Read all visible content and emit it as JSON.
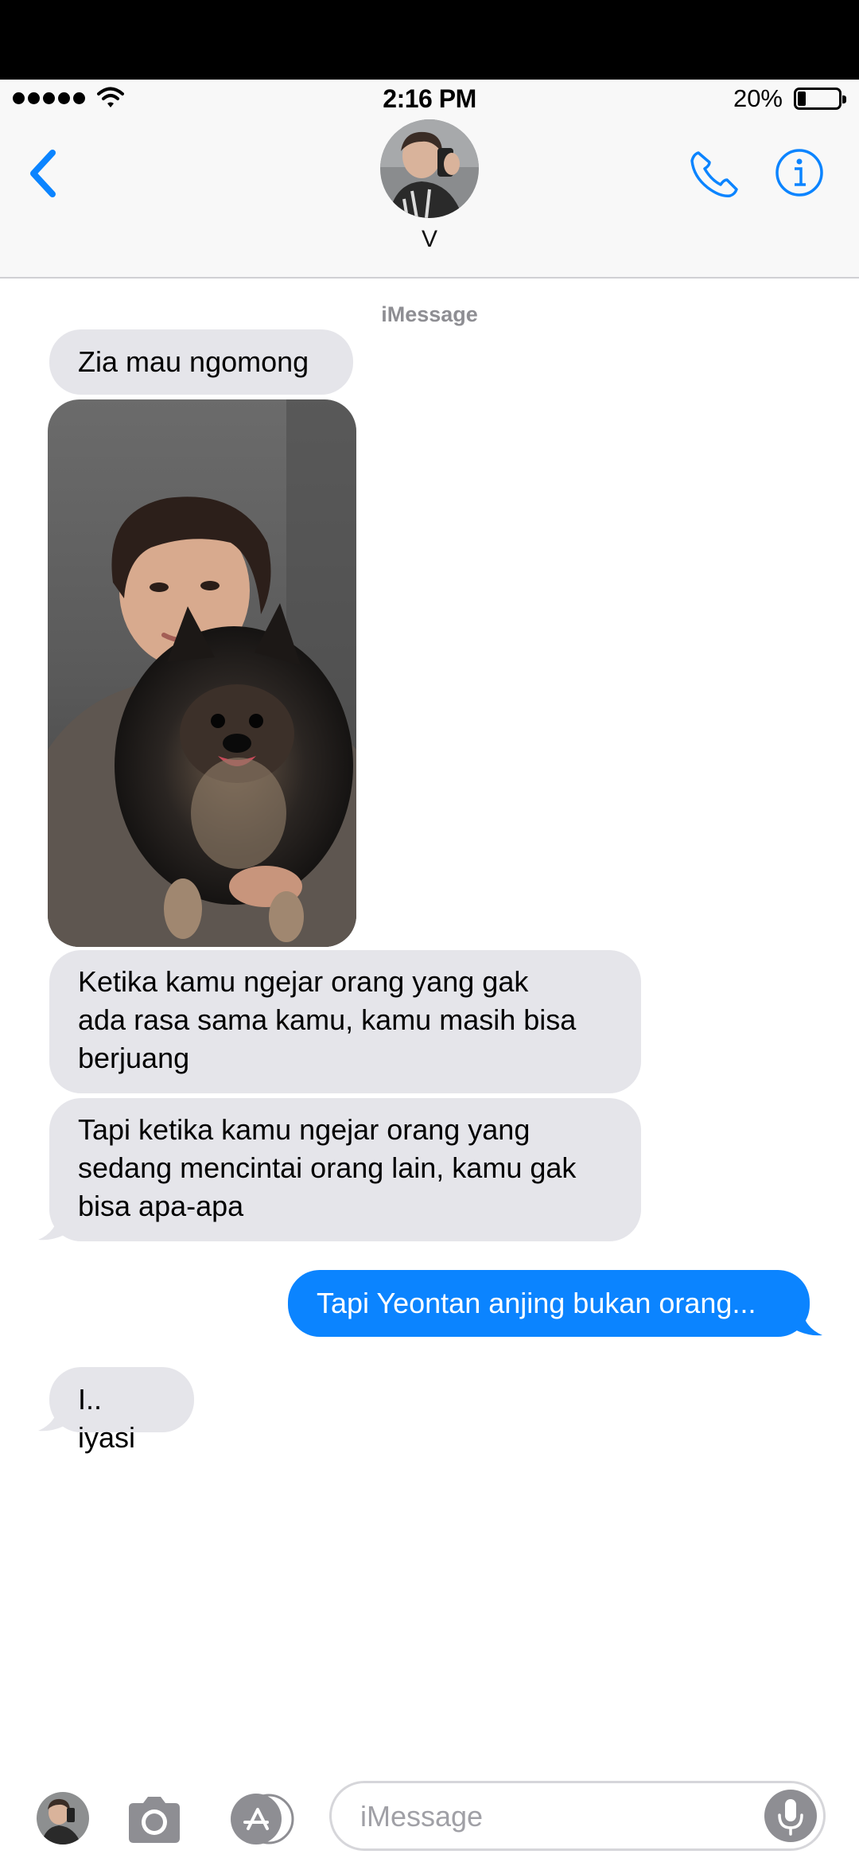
{
  "status_bar": {
    "time": "2:16 PM",
    "battery_percent": "20%",
    "battery_level": 0.2
  },
  "nav": {
    "contact_name": "V",
    "accent_color": "#0b84ff"
  },
  "conversation": {
    "service_label": "iMessage",
    "messages": [
      {
        "direction": "incoming",
        "text": "Zia mau ngomong"
      },
      {
        "direction": "incoming",
        "type": "photo"
      },
      {
        "direction": "incoming",
        "lines": [
          "Ketika kamu ngejar orang yang gak",
          "ada rasa sama kamu, kamu masih bisa",
          "berjuang"
        ]
      },
      {
        "direction": "incoming",
        "lines": [
          "Tapi ketika kamu ngejar orang yang",
          "sedang mencintai orang lain, kamu gak",
          "bisa apa-apa"
        ]
      },
      {
        "direction": "outgoing",
        "text": "Tapi Yeontan anjing bukan orang..."
      },
      {
        "direction": "incoming",
        "text": "I.. iyasi"
      }
    ]
  },
  "input_bar": {
    "placeholder": "iMessage"
  },
  "colors": {
    "incoming_bubble": "#e5e5ea",
    "outgoing_bubble": "#0b84ff",
    "nav_background": "#f8f8f8"
  },
  "icons": [
    "back-chevron-icon",
    "phone-icon",
    "info-icon",
    "camera-icon",
    "app-store-icon",
    "microphone-icon",
    "wifi-icon",
    "signal-icon",
    "battery-icon"
  ]
}
